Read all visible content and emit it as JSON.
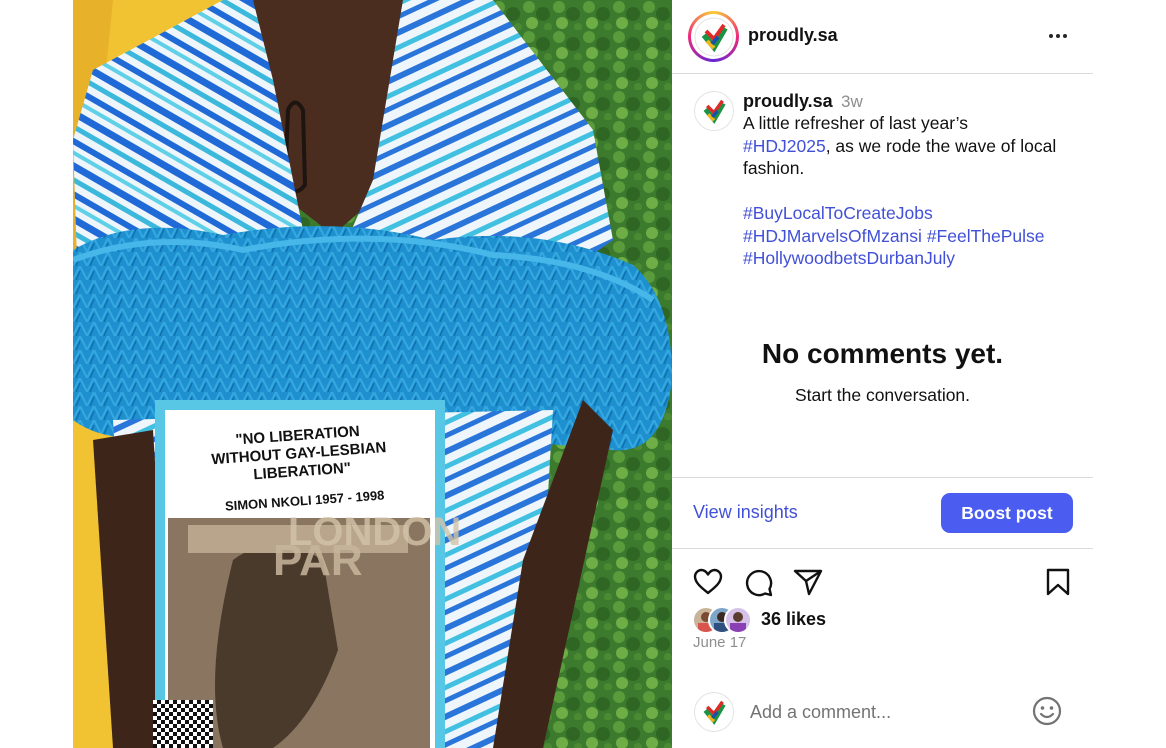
{
  "colors": {
    "link": "#4150d6",
    "accent": "#4a5df0",
    "muted": "#8e8e8e",
    "divider": "#dbdbdb"
  },
  "post": {
    "image": {
      "print_quote": "\"NO LIBERATION WITHOUT GAY-LESBIAN LIBERATION\"",
      "print_name": "SIMON NKOLI 1957 - 1998",
      "print_partial": "LONDON PAR"
    },
    "header": {
      "username": "proudly.sa",
      "more_icon": "more-horizontal-icon"
    },
    "caption": {
      "username": "proudly.sa",
      "time": "3w",
      "text_start": "A little refresher of last year’s",
      "hashtag_1": "#HDJ2025",
      "text_end": ", as we rode the wave of local fashion.",
      "hashtags": [
        "#BuyLocalToCreateJobs",
        "#HDJMarvelsOfMzansi",
        "#FeelThePulse",
        "#HollywoodbetsDurbanJuly"
      ]
    },
    "comments_empty": {
      "title": "No comments yet.",
      "subtitle": "Start the conversation."
    },
    "insights": {
      "view_label": "View insights",
      "boost_label": "Boost post"
    },
    "actions": {
      "like_icon": "heart-icon",
      "comment_icon": "comment-icon",
      "share_icon": "send-icon",
      "save_icon": "bookmark-icon"
    },
    "likes": {
      "text": "36 likes"
    },
    "date": "June 17",
    "comment_box": {
      "placeholder": "Add a comment...",
      "emoji_icon": "emoji-smile-icon"
    }
  }
}
